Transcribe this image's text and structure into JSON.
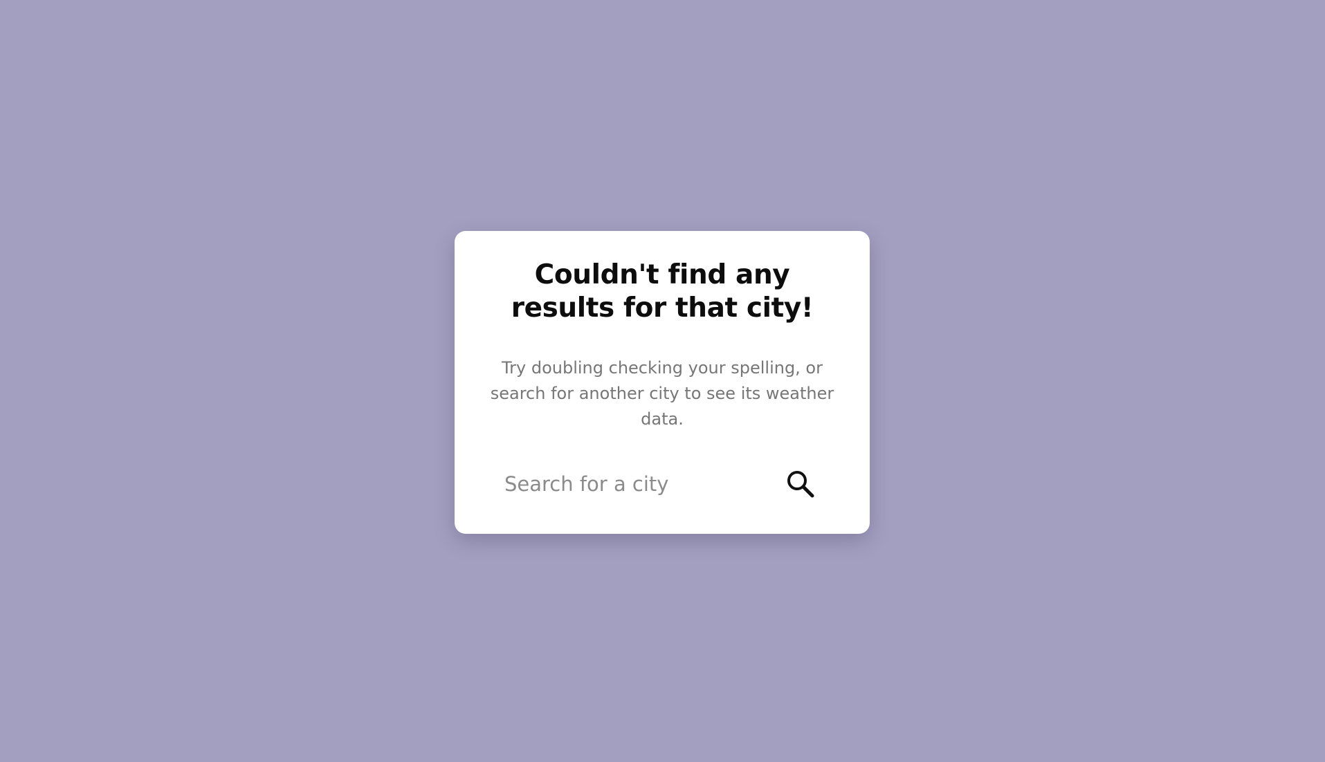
{
  "error_card": {
    "title": "Couldn't find any results for that city!",
    "message": "Try doubling checking your spelling, or search for another city to see its weather data."
  },
  "search": {
    "value": "",
    "placeholder": "Search for a city",
    "button_icon": "search-icon"
  },
  "colors": {
    "background": "#a39fc0",
    "card": "#ffffff",
    "title": "#0d0d0d",
    "message": "#767676",
    "placeholder": "#8b8b8b"
  }
}
